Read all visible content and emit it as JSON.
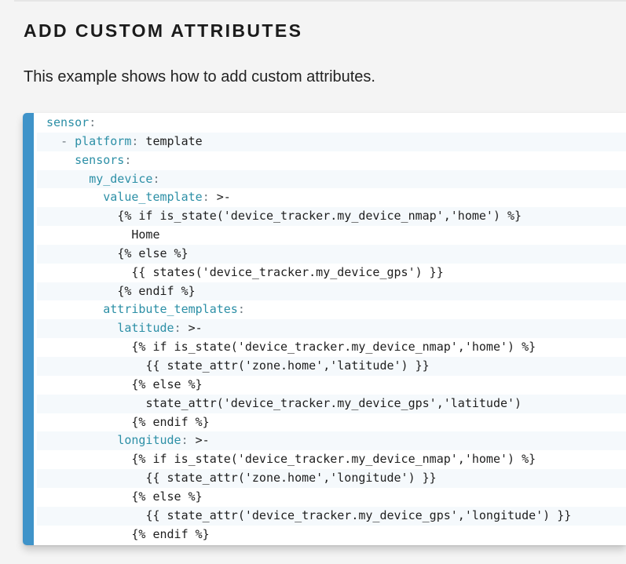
{
  "heading": "ADD CUSTOM ATTRIBUTES",
  "intro": "This example shows how to add custom attributes.",
  "colors": {
    "accent_bar": "#3f93c9",
    "yaml_key": "#2c8fa6",
    "punctuation": "#707a80",
    "code_text": "#1e1e1e",
    "page_background": "#f4f4f4"
  },
  "code": {
    "language": "yaml",
    "lines": [
      {
        "indent": "",
        "key": "sensor",
        "sep": ":",
        "value": ""
      },
      {
        "indent": "  ",
        "dash": "- ",
        "key": "platform",
        "sep": ":",
        "value": " template"
      },
      {
        "indent": "    ",
        "key": "sensors",
        "sep": ":",
        "value": ""
      },
      {
        "indent": "      ",
        "key": "my_device",
        "sep": ":",
        "value": ""
      },
      {
        "indent": "        ",
        "key": "value_template",
        "sep": ":",
        "value": " >-"
      },
      {
        "indent": "          ",
        "value": "{% if is_state('device_tracker.my_device_nmap','home') %}"
      },
      {
        "indent": "            ",
        "value": "Home"
      },
      {
        "indent": "          ",
        "value": "{% else %}"
      },
      {
        "indent": "            ",
        "value": "{{ states('device_tracker.my_device_gps') }}"
      },
      {
        "indent": "          ",
        "value": "{% endif %}"
      },
      {
        "indent": "        ",
        "key": "attribute_templates",
        "sep": ":",
        "value": ""
      },
      {
        "indent": "          ",
        "key": "latitude",
        "sep": ":",
        "value": " >-"
      },
      {
        "indent": "            ",
        "value": "{% if is_state('device_tracker.my_device_nmap','home') %}"
      },
      {
        "indent": "              ",
        "value": "{{ state_attr('zone.home','latitude') }}"
      },
      {
        "indent": "            ",
        "value": "{% else %}"
      },
      {
        "indent": "              ",
        "value": "state_attr('device_tracker.my_device_gps','latitude')"
      },
      {
        "indent": "            ",
        "value": "{% endif %}"
      },
      {
        "indent": "          ",
        "key": "longitude",
        "sep": ":",
        "value": " >-"
      },
      {
        "indent": "            ",
        "value": "{% if is_state('device_tracker.my_device_nmap','home') %}"
      },
      {
        "indent": "              ",
        "value": "{{ state_attr('zone.home','longitude') }}"
      },
      {
        "indent": "            ",
        "value": "{% else %}"
      },
      {
        "indent": "              ",
        "value": "{{ state_attr('device_tracker.my_device_gps','longitude') }}"
      },
      {
        "indent": "            ",
        "value": "{% endif %}"
      }
    ]
  }
}
